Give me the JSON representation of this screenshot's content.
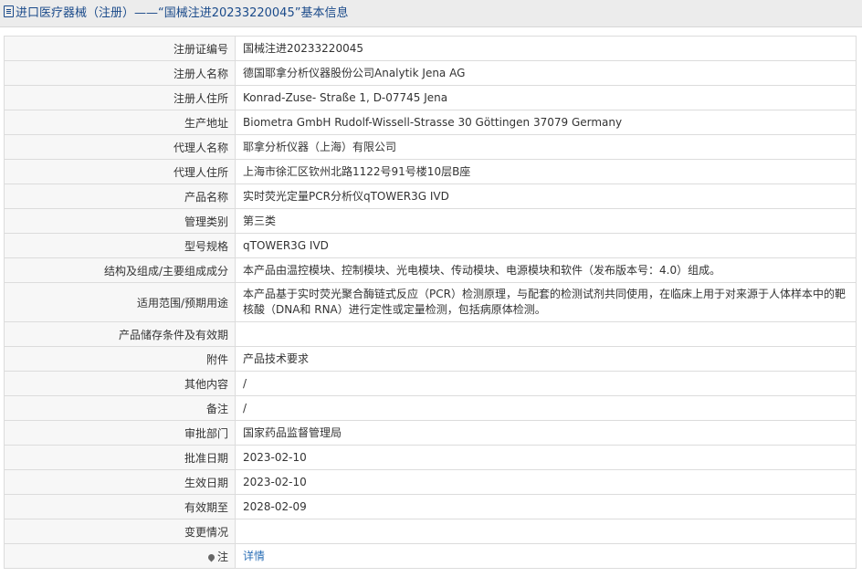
{
  "header": {
    "title": "进口医疗器械（注册）——“国械注进20233220045”基本信息"
  },
  "rows": [
    {
      "label": "注册证编号",
      "value": "国械注进20233220045"
    },
    {
      "label": "注册人名称",
      "value": "德国耶拿分析仪器股份公司Analytik Jena AG"
    },
    {
      "label": "注册人住所",
      "value": "Konrad-Zuse- Straße 1, D-07745 Jena"
    },
    {
      "label": "生产地址",
      "value": "Biometra GmbH Rudolf-Wissell-Strasse 30 Göttingen 37079 Germany"
    },
    {
      "label": "代理人名称",
      "value": "耶拿分析仪器（上海）有限公司"
    },
    {
      "label": "代理人住所",
      "value": "上海市徐汇区钦州北路1122号91号楼10层B座"
    },
    {
      "label": "产品名称",
      "value": "实时荧光定量PCR分析仪qTOWER3G IVD"
    },
    {
      "label": "管理类别",
      "value": "第三类"
    },
    {
      "label": "型号规格",
      "value": "qTOWER3G IVD"
    },
    {
      "label": "结构及组成/主要组成成分",
      "value": "本产品由温控模块、控制模块、光电模块、传动模块、电源模块和软件（发布版本号：4.0）组成。"
    },
    {
      "label": "适用范围/预期用途",
      "value": "本产品基于实时荧光聚合酶链式反应（PCR）检测原理，与配套的检测试剂共同使用，在临床上用于对来源于人体样本中的靶核酸（DNA和 RNA）进行定性或定量检测，包括病原体检测。"
    },
    {
      "label": "产品储存条件及有效期",
      "value": ""
    },
    {
      "label": "附件",
      "value": "产品技术要求"
    },
    {
      "label": "其他内容",
      "value": "/"
    },
    {
      "label": "备注",
      "value": "/"
    },
    {
      "label": "审批部门",
      "value": "国家药品监督管理局"
    },
    {
      "label": "批准日期",
      "value": "2023-02-10"
    },
    {
      "label": "生效日期",
      "value": "2023-02-10"
    },
    {
      "label": "有效期至",
      "value": "2028-02-09"
    },
    {
      "label": "变更情况",
      "value": ""
    },
    {
      "label": "注",
      "value": "详情"
    }
  ],
  "icons": {
    "title": "document-icon",
    "note": "pin-icon"
  },
  "colors": {
    "link": "#2b6fb6",
    "title": "#1a4a8a",
    "label_bg": "#f7f7f7",
    "border": "#dcdcdc"
  }
}
